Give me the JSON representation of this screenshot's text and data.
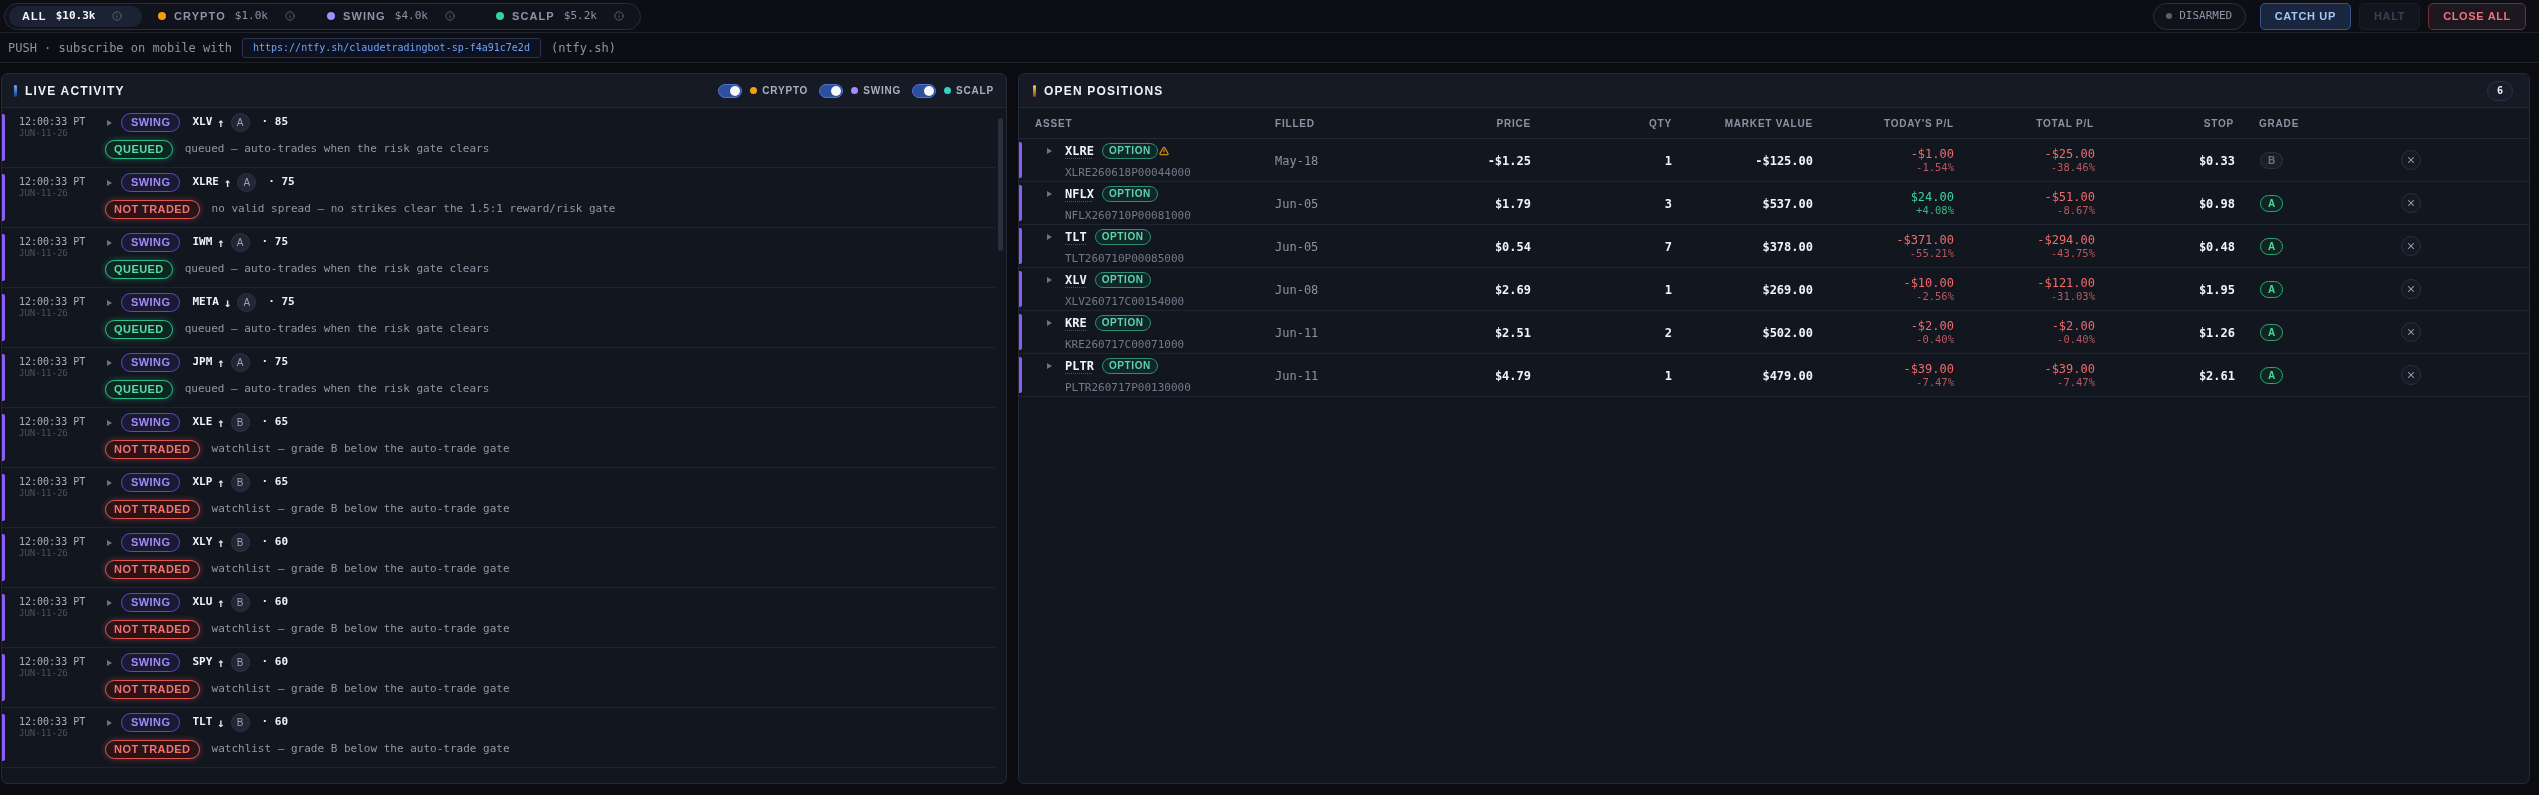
{
  "top_bar": {
    "segments": [
      {
        "label": "ALL",
        "value": "$10.3k",
        "selected": true
      },
      {
        "label": "CRYPTO",
        "value": "$1.0k",
        "color": "#f59e0b",
        "selected": false
      },
      {
        "label": "SWING",
        "value": "$4.0k",
        "color": "#a78bfa",
        "selected": false
      },
      {
        "label": "SCALP",
        "value": "$5.2k",
        "color": "#34d399",
        "selected": false
      }
    ],
    "arm_status": {
      "label": "DISARMED",
      "armed": false
    },
    "buttons": [
      {
        "label": "CATCH UP",
        "kind": "primary",
        "disabled": false
      },
      {
        "label": "HALT",
        "kind": "warning",
        "disabled": true
      },
      {
        "label": "CLOSE ALL",
        "kind": "danger",
        "disabled": false
      }
    ]
  },
  "push_notice": {
    "label": "PUSH · subscribe on mobile with",
    "link": "https://ntfy.sh/claudetradingbot-sp-f4a91c7e2d",
    "note": "(ntfy.sh)"
  },
  "live_activity": {
    "title": "LIVE ACTIVITY",
    "filters": [
      {
        "label": "CRYPTO",
        "color": "#f59e0b",
        "on": true
      },
      {
        "label": "SWING",
        "color": "#a78bfa",
        "on": true
      },
      {
        "label": "SCALP",
        "color": "#2dd4bf",
        "on": true
      }
    ],
    "events": [
      {
        "time": "12:00:33 PT",
        "date": "JUN-11-26",
        "strategy": {
          "label": "SWING",
          "kind": "swing"
        },
        "ticker": "XLV",
        "arrow": "↑",
        "grade": "A",
        "score": "· 85",
        "status": {
          "label": "QUEUED",
          "kind": "queued"
        },
        "message": "queued — auto-trades when the risk gate clears"
      },
      {
        "time": "12:00:33 PT",
        "date": "JUN-11-26",
        "strategy": {
          "label": "SWING",
          "kind": "swing"
        },
        "ticker": "XLRE",
        "arrow": "↑",
        "grade": "A",
        "score": "· 75",
        "status": {
          "label": "NOT TRADED",
          "kind": "rejected"
        },
        "message": "no valid spread — no strikes clear the 1.5:1 reward/risk gate"
      },
      {
        "time": "12:00:33 PT",
        "date": "JUN-11-26",
        "strategy": {
          "label": "SWING",
          "kind": "swing"
        },
        "ticker": "IWM",
        "arrow": "↑",
        "grade": "A",
        "score": "· 75",
        "status": {
          "label": "QUEUED",
          "kind": "queued"
        },
        "message": "queued — auto-trades when the risk gate clears"
      },
      {
        "time": "12:00:33 PT",
        "date": "JUN-11-26",
        "strategy": {
          "label": "SWING",
          "kind": "swing"
        },
        "ticker": "META",
        "arrow": "↓",
        "grade": "A",
        "score": "· 75",
        "status": {
          "label": "QUEUED",
          "kind": "queued"
        },
        "message": "queued — auto-trades when the risk gate clears"
      },
      {
        "time": "12:00:33 PT",
        "date": "JUN-11-26",
        "strategy": {
          "label": "SWING",
          "kind": "swing"
        },
        "ticker": "JPM",
        "arrow": "↑",
        "grade": "A",
        "score": "· 75",
        "status": {
          "label": "QUEUED",
          "kind": "queued"
        },
        "message": "queued — auto-trades when the risk gate clears"
      },
      {
        "time": "12:00:33 PT",
        "date": "JUN-11-26",
        "strategy": {
          "label": "SWING",
          "kind": "swing"
        },
        "ticker": "XLE",
        "arrow": "↑",
        "grade": "B",
        "score": "· 65",
        "status": {
          "label": "NOT TRADED",
          "kind": "rejected"
        },
        "message": "watchlist — grade B below the auto-trade gate"
      },
      {
        "time": "12:00:33 PT",
        "date": "JUN-11-26",
        "strategy": {
          "label": "SWING",
          "kind": "swing"
        },
        "ticker": "XLP",
        "arrow": "↑",
        "grade": "B",
        "score": "· 65",
        "status": {
          "label": "NOT TRADED",
          "kind": "rejected"
        },
        "message": "watchlist — grade B below the auto-trade gate"
      },
      {
        "time": "12:00:33 PT",
        "date": "JUN-11-26",
        "strategy": {
          "label": "SWING",
          "kind": "swing"
        },
        "ticker": "XLY",
        "arrow": "↑",
        "grade": "B",
        "score": "· 60",
        "status": {
          "label": "NOT TRADED",
          "kind": "rejected"
        },
        "message": "watchlist — grade B below the auto-trade gate"
      },
      {
        "time": "12:00:33 PT",
        "date": "JUN-11-26",
        "strategy": {
          "label": "SWING",
          "kind": "swing"
        },
        "ticker": "XLU",
        "arrow": "↑",
        "grade": "B",
        "score": "· 60",
        "status": {
          "label": "NOT TRADED",
          "kind": "rejected"
        },
        "message": "watchlist — grade B below the auto-trade gate"
      },
      {
        "time": "12:00:33 PT",
        "date": "JUN-11-26",
        "strategy": {
          "label": "SWING",
          "kind": "swing"
        },
        "ticker": "SPY",
        "arrow": "↑",
        "grade": "B",
        "score": "· 60",
        "status": {
          "label": "NOT TRADED",
          "kind": "rejected"
        },
        "message": "watchlist — grade B below the auto-trade gate"
      },
      {
        "time": "12:00:33 PT",
        "date": "JUN-11-26",
        "strategy": {
          "label": "SWING",
          "kind": "swing"
        },
        "ticker": "TLT",
        "arrow": "↓",
        "grade": "B",
        "score": "· 60",
        "status": {
          "label": "NOT TRADED",
          "kind": "rejected"
        },
        "message": "watchlist — grade B below the auto-trade gate"
      }
    ]
  },
  "open_positions": {
    "title": "OPEN POSITIONS",
    "count": "6",
    "columns": [
      "ASSET",
      "FILLED",
      "PRICE",
      "QTY",
      "MARKET VALUE",
      "TODAY'S P/L",
      "TOTAL P/L",
      "STOP",
      "GRADE"
    ],
    "rows": [
      {
        "ticker": "XLRE",
        "type": "OPTION",
        "warning": true,
        "contract": "XLRE260618P00044000",
        "filled": "May-18",
        "price": "-$1.25",
        "qty": "1",
        "market_value": "-$125.00",
        "today_pl": {
          "amount": "-$1.00",
          "percent": "-1.54%",
          "kind": "loss"
        },
        "total_pl": {
          "amount": "-$25.00",
          "percent": "-38.46%",
          "kind": "loss"
        },
        "stop": "$0.33",
        "grade": {
          "letter": "B",
          "qualified": false
        }
      },
      {
        "ticker": "NFLX",
        "type": "OPTION",
        "warning": false,
        "contract": "NFLX260710P00081000",
        "filled": "Jun-05",
        "price": "$1.79",
        "qty": "3",
        "market_value": "$537.00",
        "today_pl": {
          "amount": "$24.00",
          "percent": "+4.08%",
          "kind": "gain"
        },
        "total_pl": {
          "amount": "-$51.00",
          "percent": "-8.67%",
          "kind": "loss"
        },
        "stop": "$0.98",
        "grade": {
          "letter": "A",
          "qualified": true
        }
      },
      {
        "ticker": "TLT",
        "type": "OPTION",
        "warning": false,
        "contract": "TLT260710P00085000",
        "filled": "Jun-05",
        "price": "$0.54",
        "qty": "7",
        "market_value": "$378.00",
        "today_pl": {
          "amount": "-$371.00",
          "percent": "-55.21%",
          "kind": "loss"
        },
        "total_pl": {
          "amount": "-$294.00",
          "percent": "-43.75%",
          "kind": "loss"
        },
        "stop": "$0.48",
        "grade": {
          "letter": "A",
          "qualified": true
        }
      },
      {
        "ticker": "XLV",
        "type": "OPTION",
        "warning": false,
        "contract": "XLV260717C00154000",
        "filled": "Jun-08",
        "price": "$2.69",
        "qty": "1",
        "market_value": "$269.00",
        "today_pl": {
          "amount": "-$10.00",
          "percent": "-2.56%",
          "kind": "loss"
        },
        "total_pl": {
          "amount": "-$121.00",
          "percent": "-31.03%",
          "kind": "loss"
        },
        "stop": "$1.95",
        "grade": {
          "letter": "A",
          "qualified": true
        }
      },
      {
        "ticker": "KRE",
        "type": "OPTION",
        "warning": false,
        "contract": "KRE260717C00071000",
        "filled": "Jun-11",
        "price": "$2.51",
        "qty": "2",
        "market_value": "$502.00",
        "today_pl": {
          "amount": "-$2.00",
          "percent": "-0.40%",
          "kind": "loss"
        },
        "total_pl": {
          "amount": "-$2.00",
          "percent": "-0.40%",
          "kind": "loss"
        },
        "stop": "$1.26",
        "grade": {
          "letter": "A",
          "qualified": true
        }
      },
      {
        "ticker": "PLTR",
        "type": "OPTION",
        "warning": false,
        "contract": "PLTR260717P00130000",
        "filled": "Jun-11",
        "price": "$4.79",
        "qty": "1",
        "market_value": "$479.00",
        "today_pl": {
          "amount": "-$39.00",
          "percent": "-7.47%",
          "kind": "loss"
        },
        "total_pl": {
          "amount": "-$39.00",
          "percent": "-7.47%",
          "kind": "loss"
        },
        "stop": "$2.61",
        "grade": {
          "letter": "A",
          "qualified": true
        }
      }
    ]
  }
}
